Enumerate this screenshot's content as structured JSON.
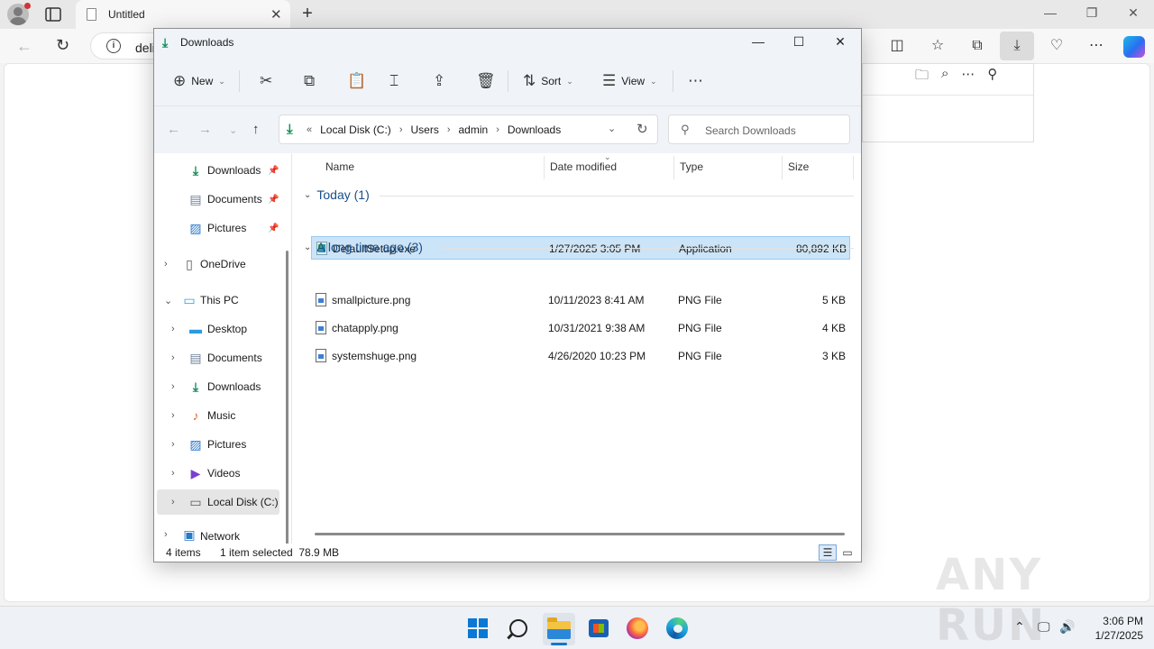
{
  "browser": {
    "tab_title": "Untitled",
    "address_text": "deli"
  },
  "explorer": {
    "window_title": "Downloads",
    "commands": {
      "new_label": "New",
      "sort_label": "Sort",
      "view_label": "View"
    },
    "breadcrumb": [
      "Local Disk (C:)",
      "Users",
      "admin",
      "Downloads"
    ],
    "search_placeholder": "Search Downloads",
    "nav": {
      "quick": [
        {
          "label": "Downloads",
          "icon": "download-icon"
        },
        {
          "label": "Documents",
          "icon": "document-icon"
        },
        {
          "label": "Pictures",
          "icon": "pictures-icon"
        }
      ],
      "onedrive": "OneDrive",
      "this_pc": "This PC",
      "pc_items": [
        {
          "label": "Desktop",
          "icon": "desktop-icon"
        },
        {
          "label": "Documents",
          "icon": "document-icon"
        },
        {
          "label": "Downloads",
          "icon": "download-icon"
        },
        {
          "label": "Music",
          "icon": "music-icon"
        },
        {
          "label": "Pictures",
          "icon": "pictures-icon"
        },
        {
          "label": "Videos",
          "icon": "videos-icon"
        },
        {
          "label": "Local Disk (C:)",
          "icon": "drive-icon"
        }
      ],
      "network": "Network"
    },
    "columns": {
      "name": "Name",
      "date": "Date modified",
      "type": "Type",
      "size": "Size"
    },
    "groups": [
      {
        "title": "Today (1)",
        "files": [
          {
            "name": "DefaultSetup.exe",
            "date": "1/27/2025 3:05 PM",
            "type": "Application",
            "size": "80,892 KB",
            "selected": true
          }
        ]
      },
      {
        "title": "A long time ago (3)",
        "files": [
          {
            "name": "smallpicture.png",
            "date": "10/11/2023 8:41 AM",
            "type": "PNG File",
            "size": "5 KB"
          },
          {
            "name": "chatapply.png",
            "date": "10/31/2021 9:38 AM",
            "type": "PNG File",
            "size": "4 KB"
          },
          {
            "name": "systemshuge.png",
            "date": "4/26/2020 10:23 PM",
            "type": "PNG File",
            "size": "3 KB"
          }
        ]
      }
    ],
    "status": {
      "count": "4 items",
      "selection": "1 item selected  78.9 MB"
    }
  },
  "taskbar": {
    "time": "3:06 PM",
    "date": "1/27/2025"
  },
  "watermark": "ANY RUN",
  "colors": {
    "accent": "#0a78d4",
    "selection": "#cce4f7",
    "group_header": "#1a4f8c"
  }
}
